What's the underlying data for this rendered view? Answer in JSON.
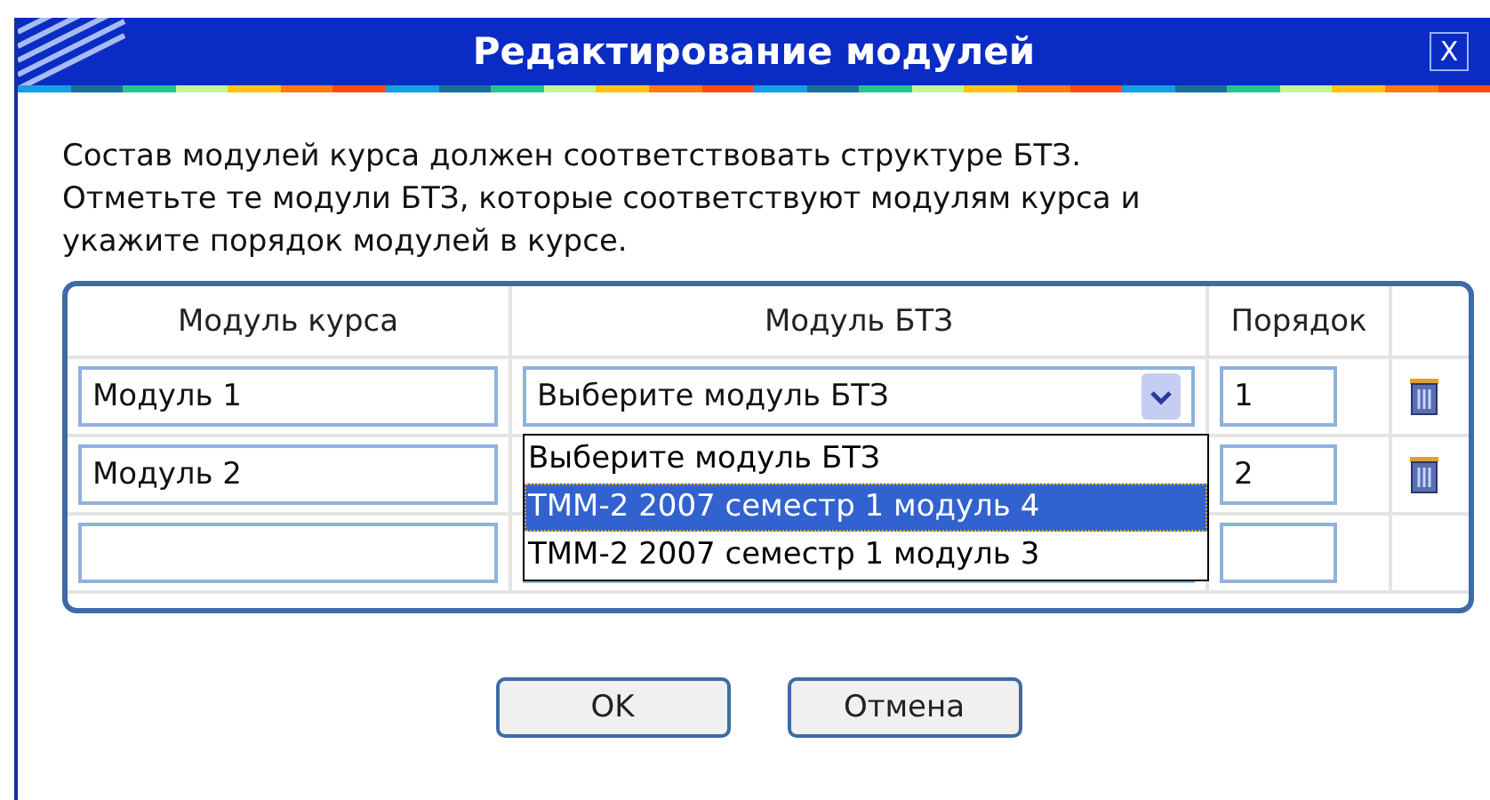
{
  "window": {
    "title": "Редактирование модулей",
    "close_label": "X"
  },
  "instructions": [
    "Состав модулей курса должен соответствовать структуре БТЗ.",
    "Отметьте те модули БТЗ, которые соответствуют модулям курса и",
    "укажите порядок модулей в курсе."
  ],
  "table": {
    "columns": [
      "Модуль курса",
      "Модуль БТЗ",
      "Порядок"
    ],
    "rows": [
      {
        "course_module": "Модуль 1",
        "btz_module": "Выберите модуль БТЗ",
        "order": "1",
        "deletable": true
      },
      {
        "course_module": "Модуль 2",
        "order": "2",
        "deletable": true,
        "dropdown_open": true
      },
      {
        "deletable": false
      }
    ],
    "dropdown_options": [
      {
        "label": "Выберите модуль БТЗ",
        "selected": false
      },
      {
        "label": "ТММ-2 2007 семестр 1 модуль 4",
        "selected": true
      },
      {
        "label": "ТММ-2 2007 семестр 1 модуль 3",
        "selected": false
      }
    ]
  },
  "buttons": [
    "OK",
    "Отмена"
  ]
}
